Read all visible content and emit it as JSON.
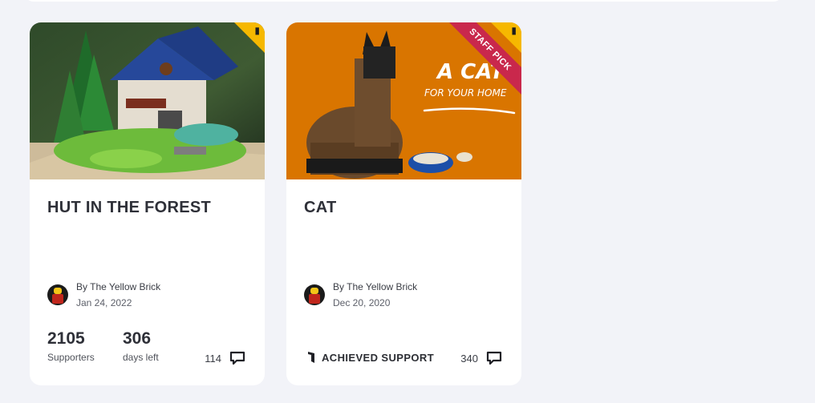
{
  "cards": [
    {
      "title": "HUT IN THE FOREST",
      "author": "By The Yellow Brick",
      "date": "Jan 24, 2022",
      "supporters_value": "2105",
      "supporters_label": "Supporters",
      "days_value": "306",
      "days_label": "days left",
      "comments": "114",
      "image_icon": "lego-forest-hut-image"
    },
    {
      "title": "CAT",
      "author": "By The Yellow Brick",
      "date": "Dec 20, 2020",
      "achieved_label": "ACHIEVED SUPPORT",
      "comments": "340",
      "ribbon": "STAFF PICK",
      "image_text_1": "A CAT",
      "image_text_2": "FOR YOUR HOME",
      "image_icon": "lego-cat-image"
    }
  ],
  "colors": {
    "background": "#f2f3f8",
    "card": "#ffffff",
    "corner_tag": "#f6b800",
    "ribbon": "#c9284c",
    "cat_bg": "#d97500"
  }
}
